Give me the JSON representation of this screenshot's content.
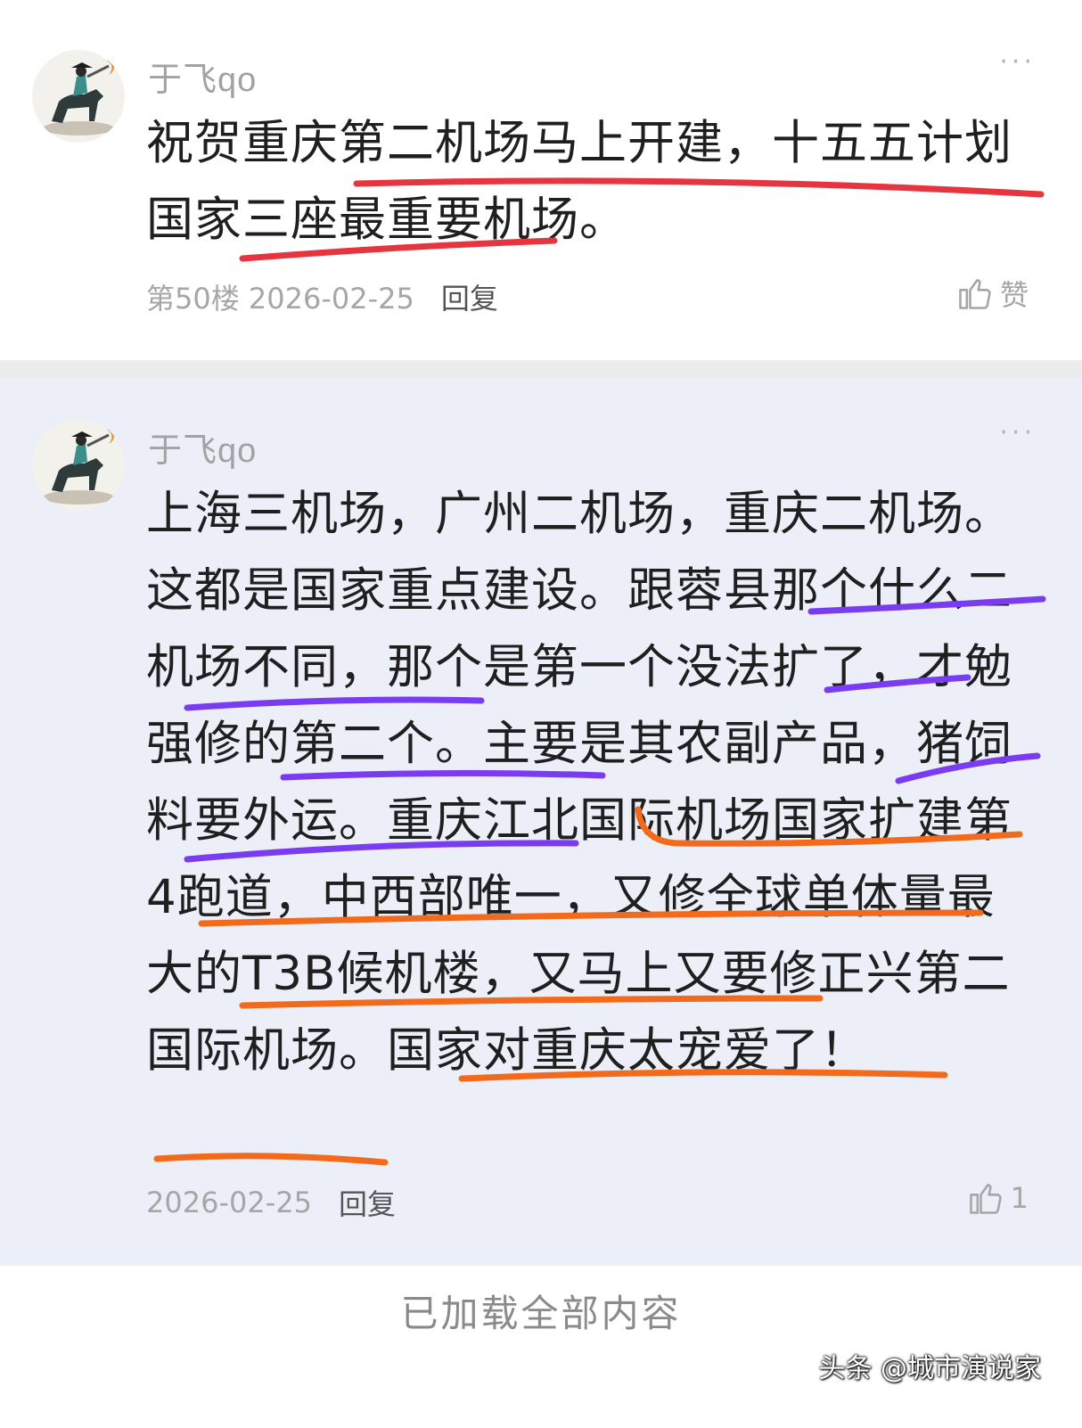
{
  "comments": [
    {
      "username": "于飞qo",
      "text": "祝贺重庆第二机场马上开建，十五五计划国家三座最重要机场。",
      "meta": "第50楼 2026-02-25",
      "reply_label": "回复",
      "like_label": "赞"
    },
    {
      "username": "于飞qo",
      "text": "上海三机场，广州二机场，重庆二机场。这都是国家重点建设。跟蓉县那个什么二机场不同，那个是第一个没法扩了，才勉强修的第二个。主要是其农副产品，猪饲料要外运。重庆江北国际机场国家扩建第4跑道，中西部唯一，又修全球单体量最大的T3B候机楼，又马上又要修正兴第二国际机场。国家对重庆太宠爱了！",
      "meta": "2026-02-25",
      "reply_label": "回复",
      "like_count": "1"
    }
  ],
  "footer": {
    "status": "已加载全部内容"
  },
  "watermark": "头条 @城市演说家",
  "icons": {
    "more": "more-dots-icon",
    "like": "thumbs-up-icon",
    "avatar": "horse-rider-avatar"
  },
  "colors": {
    "red_underline": "#e5353f",
    "purple_underline": "#7a3cf0",
    "orange_underline": "#f26a1c",
    "highlight_bg": "#eceef8"
  }
}
